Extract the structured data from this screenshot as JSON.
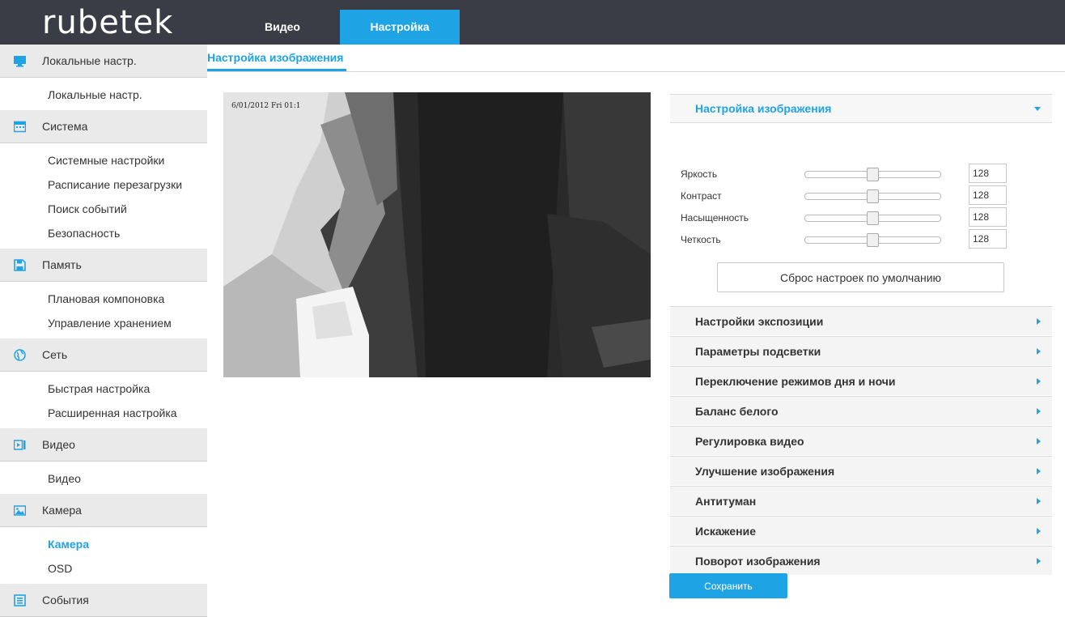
{
  "header": {
    "logo": "rubetek",
    "tabs": [
      {
        "label": "Видео",
        "active": false
      },
      {
        "label": "Настройка",
        "active": true
      }
    ]
  },
  "sidebar": {
    "sections": [
      {
        "icon": "monitor-icon",
        "label": "Локальные настр.",
        "items": [
          "Локальные настр."
        ]
      },
      {
        "icon": "system-icon",
        "label": "Система",
        "items": [
          "Системные настройки",
          "Расписание перезагрузки",
          "Поиск событий",
          "Безопасность"
        ]
      },
      {
        "icon": "floppy-disk-icon",
        "label": "Память",
        "items": [
          "Плановая компоновка",
          "Управление хранением"
        ]
      },
      {
        "icon": "globe-icon",
        "label": "Сеть",
        "items": [
          "Быстрая настройка",
          "Расширенная настройка"
        ]
      },
      {
        "icon": "video-icon",
        "label": "Видео",
        "items": [
          "Видео"
        ]
      },
      {
        "icon": "image-icon",
        "label": "Камера",
        "items": [
          "Камера",
          "OSD"
        ],
        "active_item": "Камера"
      },
      {
        "icon": "events-icon",
        "label": "События",
        "items": []
      }
    ]
  },
  "page": {
    "title": "Настройка изображения"
  },
  "preview": {
    "osd_timestamp": "6/01/2012 Fri 01:1"
  },
  "image_settings": {
    "title": "Настройка изображения",
    "sliders": [
      {
        "label": "Яркость",
        "value": "128",
        "level": 0.5
      },
      {
        "label": "Контраст",
        "value": "128",
        "level": 0.5
      },
      {
        "label": "Насыщенность",
        "value": "128",
        "level": 0.5
      },
      {
        "label": "Четкость",
        "value": "128",
        "level": 0.5
      }
    ],
    "reset_label": "Сброс настроек по умолчанию"
  },
  "collapsed_sections": [
    "Настройки экспозиции",
    "Параметры подсветки",
    "Переключение режимов дня и ночи",
    "Баланс белого",
    "Регулировка видео",
    "Улучшение изображения",
    "Антитуман",
    "Искажение",
    "Поворот изображения"
  ],
  "save_label": "Сохранить",
  "colors": {
    "accent": "#1ea3e4",
    "topbar": "#3a3d46"
  }
}
